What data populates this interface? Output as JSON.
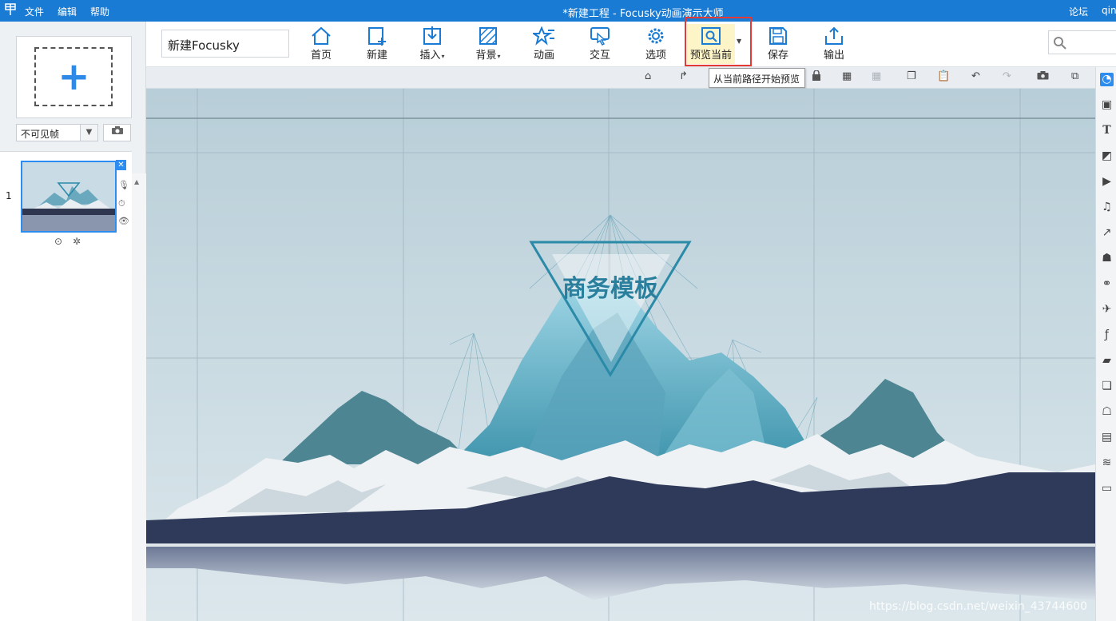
{
  "titlebar": {
    "logo": "",
    "menus": [
      "文件",
      "编辑",
      "帮助"
    ],
    "title": "*新建工程 - Focusky动画演示大师",
    "forum": "论坛",
    "user": "qin"
  },
  "left": {
    "add_frame_icon": "plus-icon",
    "frame_select": "不可见帧",
    "slide_number": "1"
  },
  "toolbar": {
    "project_name": "新建Focusky",
    "tools": [
      {
        "label": "首页",
        "icon": "home-icon"
      },
      {
        "label": "新建",
        "icon": "new-frame-icon"
      },
      {
        "label": "插入",
        "icon": "insert-icon",
        "dropdown": true
      },
      {
        "label": "背景",
        "icon": "background-icon",
        "dropdown": true
      },
      {
        "label": "动画",
        "icon": "animation-icon"
      },
      {
        "label": "交互",
        "icon": "interact-icon"
      },
      {
        "label": "选项",
        "icon": "gear-icon"
      },
      {
        "label": "预览当前",
        "icon": "preview-icon",
        "dropdown": true,
        "active": true
      },
      {
        "label": "保存",
        "icon": "save-icon"
      },
      {
        "label": "输出",
        "icon": "export-icon"
      }
    ]
  },
  "tooltip": "从当前路径开始预览",
  "canvas": {
    "title": "商务模板",
    "watermark": "https://blog.csdn.net/weixin_43744600"
  },
  "colors": {
    "titlebar": "#1a7bd4",
    "accent": "#2d8cf0",
    "highlight": "#e53935",
    "triangle": "#2a8aa8"
  }
}
